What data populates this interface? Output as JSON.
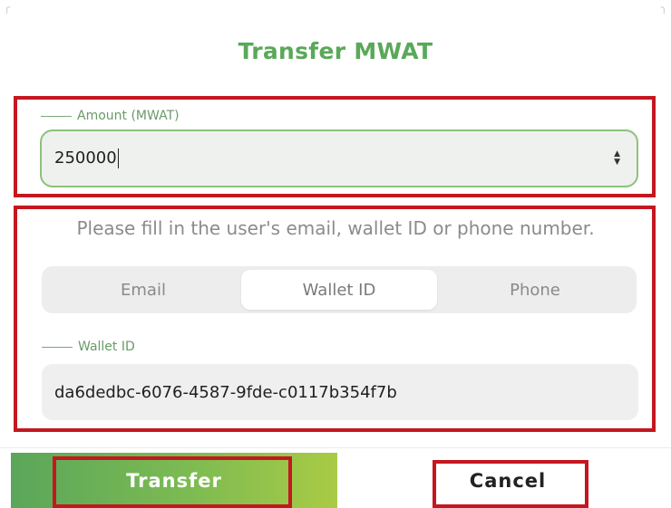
{
  "dialog": {
    "title": "Transfer MWAT"
  },
  "amount": {
    "label": "Amount (MWAT)",
    "value": "250000",
    "stepper_up": "▲",
    "stepper_down": "▼"
  },
  "recipient": {
    "instruction": "Please fill in the user's email, wallet ID or phone number.",
    "tabs": [
      {
        "label": "Email",
        "selected": false
      },
      {
        "label": "Wallet ID",
        "selected": true
      },
      {
        "label": "Phone",
        "selected": false
      }
    ],
    "wallet_label": "Wallet ID",
    "wallet_value": "da6dedbc-6076-4587-9fde-c0117b354f7b"
  },
  "actions": {
    "transfer_label": "Transfer",
    "cancel_label": "Cancel"
  },
  "colors": {
    "accent": "#5aa85a",
    "highlight": "#c4171f",
    "button_gradient_start": "#5aa65a",
    "button_gradient_end": "#a9cb45"
  },
  "icons": {
    "corner_marks": [
      "╭",
      "╮"
    ]
  }
}
